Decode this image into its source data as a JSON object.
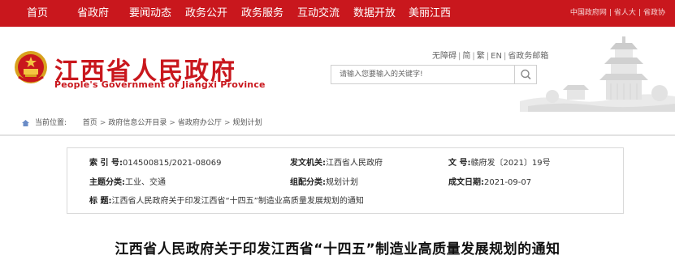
{
  "nav": {
    "items": [
      "首页",
      "省政府",
      "要闻动态",
      "政务公开",
      "政务服务",
      "互动交流",
      "数据开放",
      "美丽江西"
    ],
    "right_links": [
      "中国政府网",
      "省人大",
      "省政协"
    ]
  },
  "header": {
    "logo_cn": "江西省人民政府",
    "logo_en": "People's Government of Jiangxi Province",
    "util_links": [
      "无障碍",
      "简",
      "繁",
      "EN",
      "省政务邮箱"
    ],
    "search_placeholder": "请输入您要输入的关键字!"
  },
  "breadcrumb": {
    "prefix": "当前位置:",
    "items": [
      "首页",
      "政府信息公开目录",
      "省政府办公厅",
      "规划计划"
    ]
  },
  "meta": {
    "index_no_label": "索  引  号:",
    "index_no": "014500815/2021-08069",
    "issuer_label": "发文机关:",
    "issuer": "江西省人民政府",
    "doc_no_label": "文       号:",
    "doc_no": "赣府发〔2021〕19号",
    "topic_label": "主题分类:",
    "topic": "工业、交通",
    "group_label": "组配分类:",
    "group": "规划计划",
    "date_label": "成文日期:",
    "date": "2021-09-07",
    "title_label": "标       题:",
    "title": "江西省人民政府关于印发江西省“十四五”制造业高质量发展规划的通知"
  },
  "document": {
    "title": "江西省人民政府关于印发江西省“十四五”制造业高质量发展规划的通知"
  },
  "colors": {
    "brand_red": "#c9171d",
    "border": "#d9d9d9"
  },
  "icons": [
    "national-emblem-icon",
    "search-icon",
    "location-icon",
    "pavilion-illustration"
  ]
}
